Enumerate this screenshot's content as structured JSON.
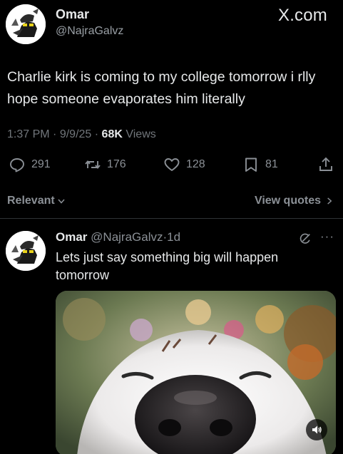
{
  "tweet": {
    "author_name": "Omar",
    "author_handle": "@NajraGalvz",
    "watermark": "X.com",
    "text": "Charlie kirk is coming to my college tomorrow i rlly hope someone evaporates him literally",
    "time": "1:37 PM",
    "date": "9/9/25",
    "views_count": "68K",
    "views_label": "Views",
    "meta_sep": "·",
    "replies": "291",
    "reposts": "176",
    "likes": "128",
    "bookmarks": "81"
  },
  "filters": {
    "sort_label": "Relevant",
    "view_quotes_label": "View quotes"
  },
  "reply": {
    "author_name": "Omar",
    "author_handle": "@NajraGalvz",
    "sep": "·",
    "time": "1d",
    "more": "···",
    "text": "Lets just say something big will happen tomorrow"
  },
  "icons": {
    "reply": "reply-icon",
    "repost": "repost-icon",
    "like": "heart-icon",
    "bookmark": "bookmark-icon",
    "share": "share-icon",
    "sort_chevron": "chevron-down-icon",
    "quotes_chevron": "chevron-right-icon",
    "grok": "grok-icon",
    "sound": "speaker-icon"
  },
  "colors": {
    "background": "#000000",
    "text_primary": "#e7e9ea",
    "text_secondary": "#71767b",
    "divider": "#2f3336"
  }
}
